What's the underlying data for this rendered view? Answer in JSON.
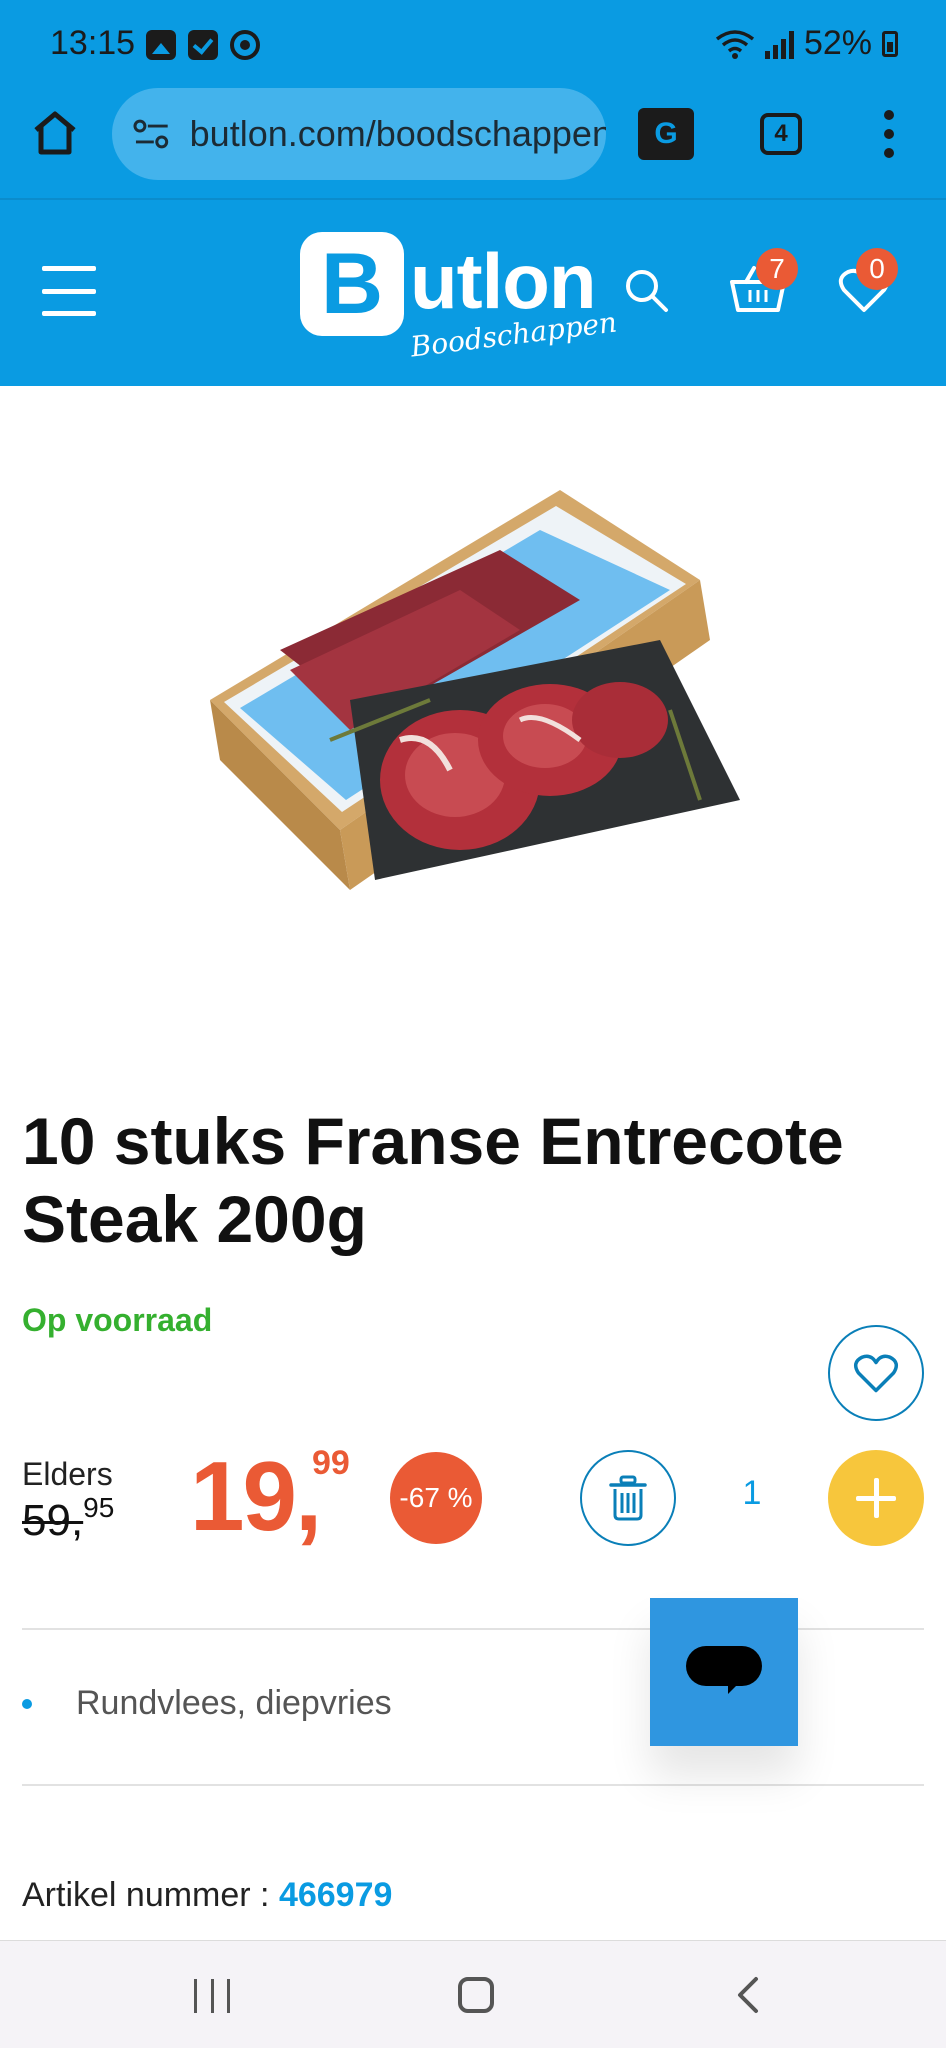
{
  "status_bar": {
    "time": "13:15",
    "battery": "52%"
  },
  "browser": {
    "url": "butlon.com/boodschappen",
    "tab_count": "4"
  },
  "header": {
    "logo_letter": "B",
    "logo_word": "utlon",
    "logo_tagline": "Boodschappen",
    "cart_count": "7",
    "favorites_count": "0",
    "brand_color": "#0a9be2"
  },
  "product": {
    "title": "10 stuks Franse Entrecote Steak 200g",
    "stock_status": "Op voorraad",
    "elders_label": "Elders",
    "old_price_int": "59,",
    "old_price_dec": "95",
    "price_int": "19,",
    "price_dec": "99",
    "discount": "-67 %",
    "quantity": "1",
    "features": [
      "Rundvlees, diepvries"
    ],
    "article_label": "Artikel nummer : ",
    "article_number": "466979",
    "price_color": "#ea5a35",
    "stock_color": "#35b02f",
    "add_button_color": "#f7c63c"
  },
  "icons": {
    "home": "home-icon",
    "site_settings": "tune-icon",
    "translate": "translate-icon",
    "tabs": "tabs-icon",
    "overflow_menu": "more-vert-icon",
    "menu": "hamburger-icon",
    "search": "search-icon",
    "cart": "basket-icon",
    "favorites": "heart-icon",
    "delete": "trash-icon",
    "add": "plus-icon",
    "chat": "chat-icon"
  }
}
